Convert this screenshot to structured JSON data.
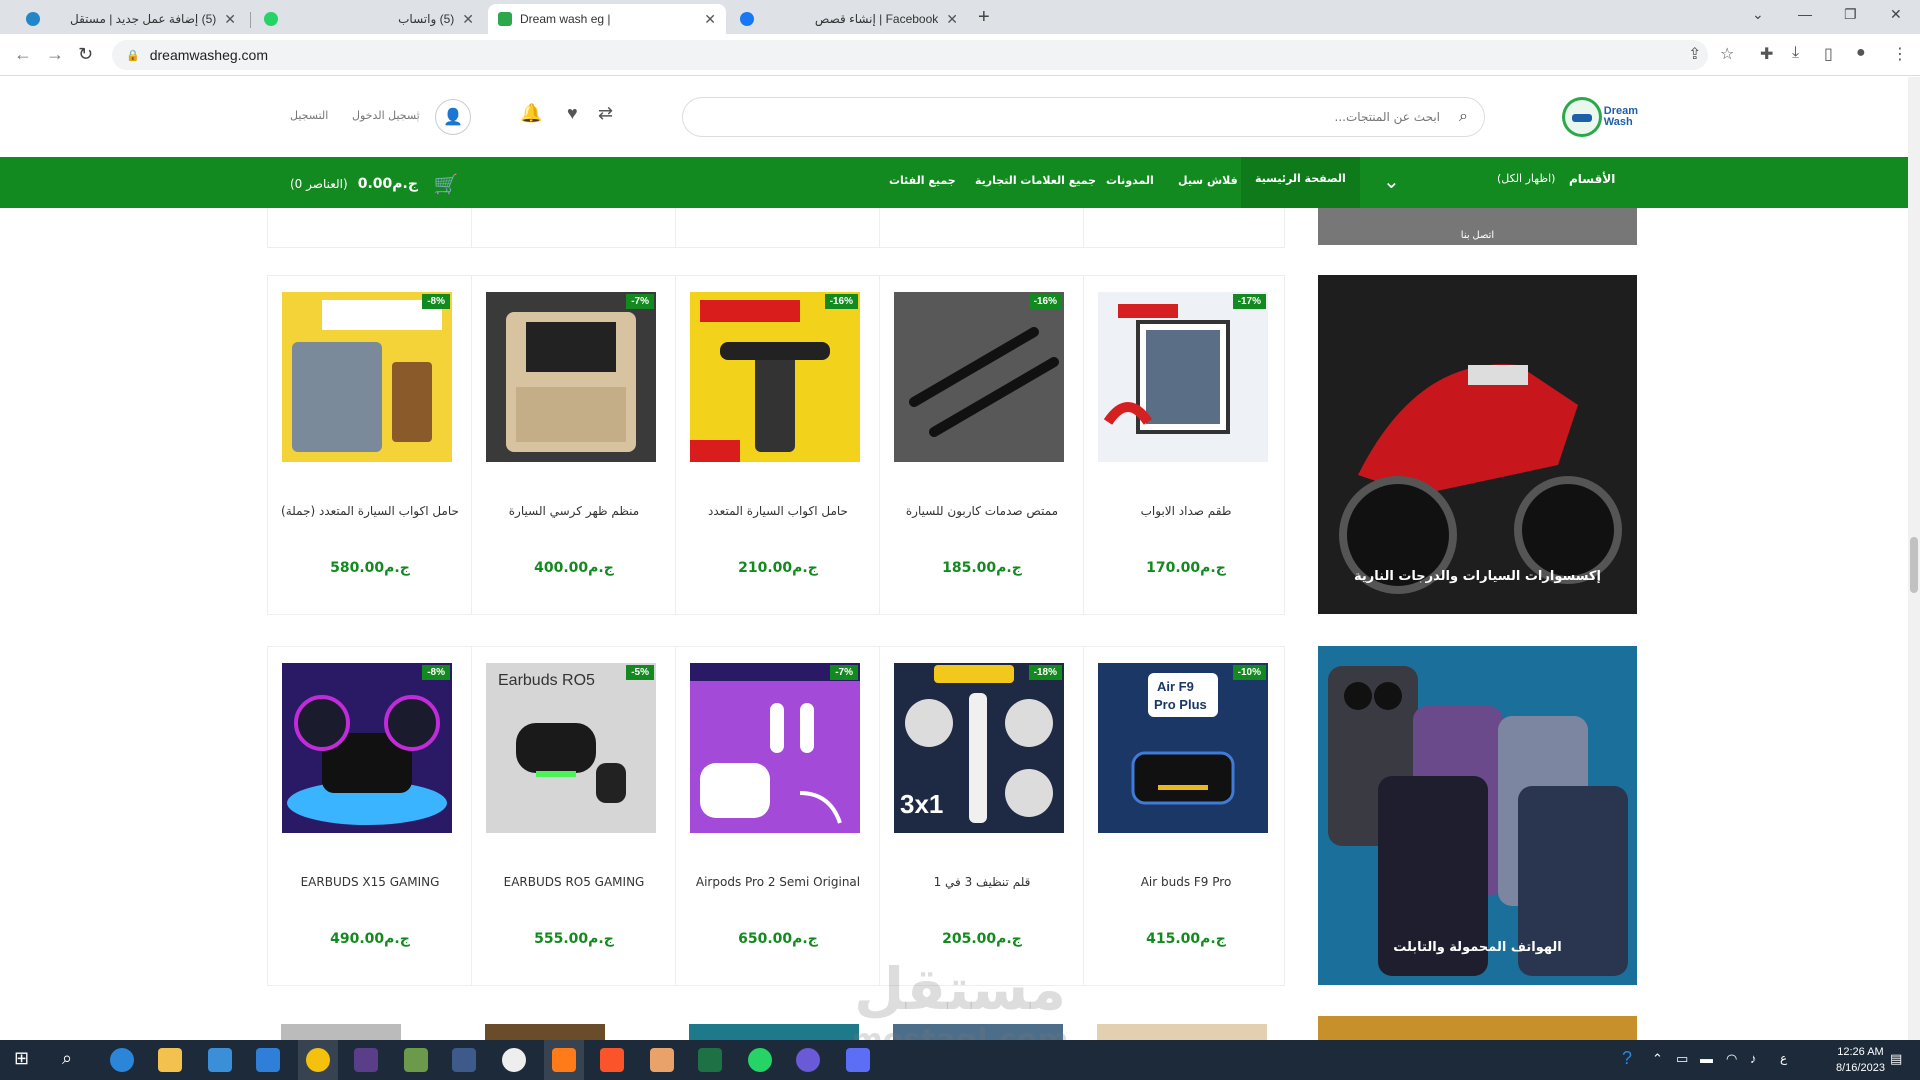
{
  "browser": {
    "tabs": [
      {
        "title": "(5) إضافة عمل جديد | مستقل",
        "active": false
      },
      {
        "title": "(5) واتساب",
        "active": false
      },
      {
        "title": "Dream wash eg |",
        "active": true
      },
      {
        "title": "Facebook | إنشاء قصص",
        "active": false
      }
    ],
    "url": "dreamwasheg.com"
  },
  "header": {
    "logo_line1": "Dream",
    "logo_line2": "Wash",
    "search_placeholder": "ابحث عن المنتجات...",
    "login_label": "تسجيل الدخول",
    "register_label": "التسجيل"
  },
  "nav": {
    "categories_label": "الأقسام",
    "show_all_label": "(اظهار الكل)",
    "items": [
      {
        "label": "الصفحة الرئيسية",
        "active": true
      },
      {
        "label": "فلاش سيل",
        "active": false
      },
      {
        "label": "المدونات",
        "active": false
      },
      {
        "label": "جميع العلامات التجارية",
        "active": false
      },
      {
        "label": "جميع الفئات",
        "active": false
      }
    ],
    "cart_amount": "ج.م0.00",
    "cart_count": "(0 العناصر)"
  },
  "top_banner_stub": "اتصل بنا",
  "sections": [
    {
      "banner_title": "إكسسوارات السيارات والدرجات النارية",
      "products": [
        {
          "name": "حامل اكواب السيارة المتعدد (جملة)",
          "price": "ج.م580.00",
          "discount": "-8%"
        },
        {
          "name": "منظم ظهر كرسي السيارة",
          "price": "ج.م400.00",
          "discount": "-7%"
        },
        {
          "name": "حامل اكواب السيارة المتعدد",
          "price": "ج.م210.00",
          "discount": "-16%"
        },
        {
          "name": "ممتص صدمات كاربون للسيارة",
          "price": "ج.م185.00",
          "discount": "-16%"
        },
        {
          "name": "طقم صداد الابواب",
          "price": "ج.م170.00",
          "discount": "-17%"
        }
      ]
    },
    {
      "banner_title": "الهواتف المحمولة والتابلت",
      "products": [
        {
          "name": "EARBUDS X15 GAMING",
          "price": "ج.م490.00",
          "discount": "-8%"
        },
        {
          "name": "EARBUDS RO5 GAMING",
          "price": "ج.م555.00",
          "discount": "-5%"
        },
        {
          "name": "Airpods Pro 2 Semi Original",
          "price": "ج.م650.00",
          "discount": "-7%"
        },
        {
          "name": "قلم تنظيف 3 في 1",
          "price": "ج.م205.00",
          "discount": "-18%"
        },
        {
          "name": "Air buds F9 Pro",
          "price": "ج.م415.00",
          "discount": "-10%"
        }
      ]
    }
  ],
  "watermark": {
    "line1": "مستقل",
    "line2": "mostaql.com"
  },
  "taskbar": {
    "time": "12:26 AM",
    "date": "8/16/2023"
  },
  "colors": {
    "brand_green": "#138a1f",
    "taskbar": "#1c2a3a"
  }
}
